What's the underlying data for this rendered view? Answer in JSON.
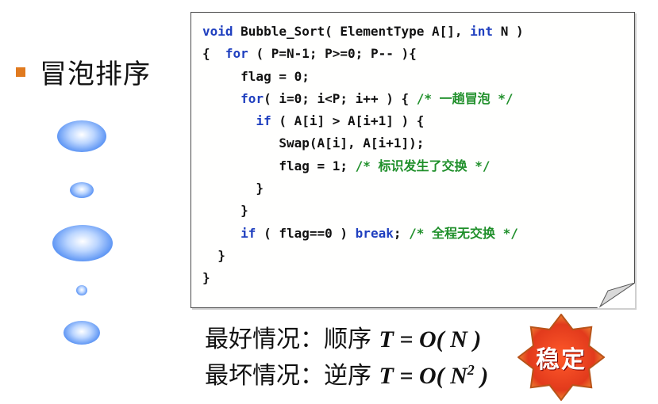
{
  "slide": {
    "title": "冒泡排序"
  },
  "code": {
    "l1": [
      "void",
      " Bubble_Sort( ElementType A[], ",
      "int",
      " N )"
    ],
    "l2": [
      "{  ",
      "for",
      " ( P=N-1; P>=0; P-- ){"
    ],
    "l3": [
      "     flag = 0;"
    ],
    "l4": [
      "     ",
      "for",
      "( i=0; i<P; i++ ) { ",
      "/* 一趟冒泡 */"
    ],
    "l5": [
      "       ",
      "if",
      " ( A[i] > A[i+1] ) {"
    ],
    "l6": [
      "          Swap(A[i], A[i+1]);"
    ],
    "l7": [
      "          flag = 1; ",
      "/* 标识发生了交换 */"
    ],
    "l8": [
      "       }"
    ],
    "l9": [
      "     }"
    ],
    "l10": [
      "     ",
      "if",
      " ( flag==0 ) ",
      "break",
      "; ",
      "/* 全程无交换 */"
    ],
    "l11": [
      "  }"
    ],
    "l12": [
      "}"
    ]
  },
  "complexity": {
    "best_label": "最好情况：顺序 ",
    "best_formula": "T = O( N )",
    "worst_label": "最坏情况：逆序 ",
    "worst_formula": "T = O( N",
    "worst_exp": "2",
    "worst_close": " )"
  },
  "badge": {
    "label": "稳定",
    "fill": "#e23a1c",
    "edge": "#f2a13a"
  }
}
